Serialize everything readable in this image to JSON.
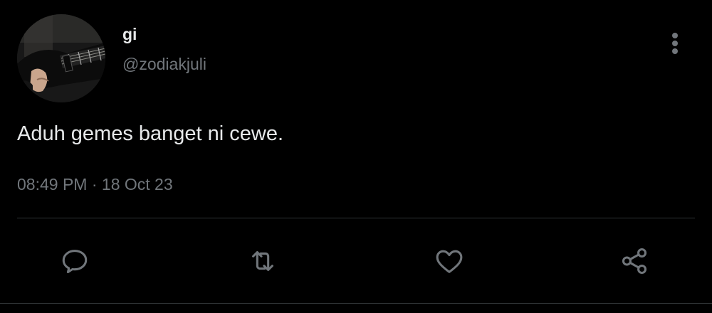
{
  "user": {
    "display_name": "gi",
    "handle": "@zodiakjuli"
  },
  "tweet": {
    "text": "Aduh gemes banget ni cewe.",
    "time": "08:49 PM",
    "separator": "·",
    "date": "18 Oct 23"
  },
  "actions": [
    "reply-icon",
    "retweet-icon",
    "like-icon",
    "share-icon"
  ],
  "colors": {
    "background": "#000000",
    "primary_text": "#e7e9ea",
    "secondary_text": "#71767b",
    "divider": "#2f3336",
    "icon": "#71767b"
  }
}
